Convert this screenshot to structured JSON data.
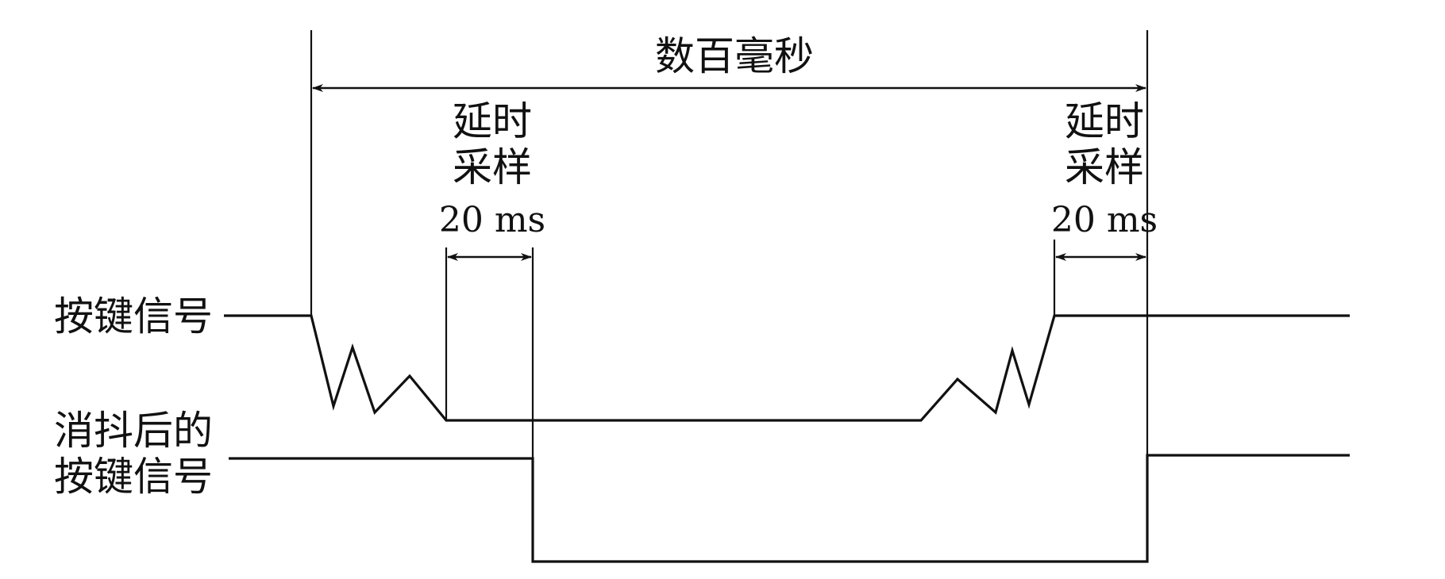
{
  "labels": {
    "span": "数百毫秒",
    "delay_left_line1": "延时",
    "delay_left_line2": "采样",
    "delay_left_line3": "20 ms",
    "delay_right_line1": "延时",
    "delay_right_line2": "采样",
    "delay_right_line3": "20 ms",
    "raw_signal": "按键信号",
    "debounced_line1": "消抖后的",
    "debounced_line2": "按键信号"
  },
  "colors": {
    "ink": "#111111",
    "background": "#ffffff"
  }
}
